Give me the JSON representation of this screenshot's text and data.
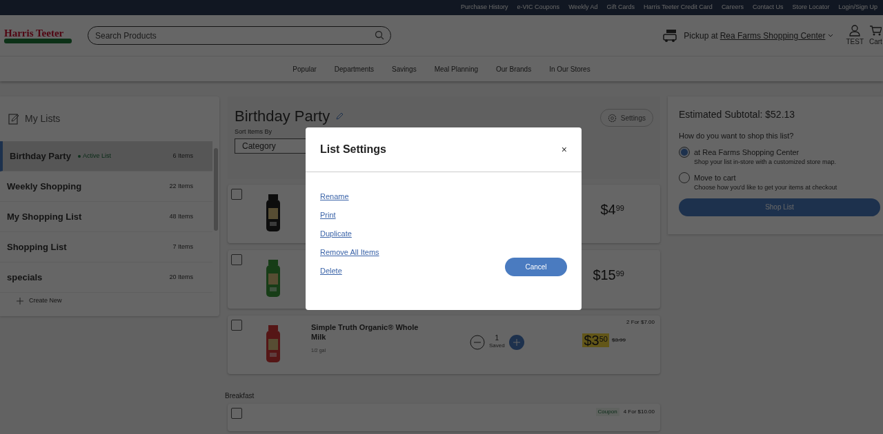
{
  "top_links": [
    "Purchase History",
    "e-VIC Coupons",
    "Weekly Ad",
    "Gift Cards",
    "Harris Teeter Credit Card",
    "Careers",
    "Contact Us",
    "Store Locator",
    "Login/Sign Up"
  ],
  "header": {
    "logo": "Harris Teeter",
    "search_placeholder": "Search Products",
    "pickup_label": "Pickup at",
    "store": "Rea Farms Shopping Center",
    "account": "TEST",
    "cart": "Cart"
  },
  "nav": [
    "Popular",
    "Departments",
    "Savings",
    "Meal Planning",
    "Our Brands",
    "In Our Stores"
  ],
  "sidebar": {
    "title": "My Lists",
    "lists": [
      {
        "name": "Birthday Party",
        "count": "6 Items",
        "selected": true,
        "badge": "Active List"
      },
      {
        "name": "Weekly Shopping",
        "count": "22 Items",
        "selected": false
      },
      {
        "name": "My Shopping List",
        "count": "48 Items",
        "selected": false
      },
      {
        "name": "Shopping List",
        "count": "7 Items",
        "selected": false
      },
      {
        "name": "specials",
        "count": "20 Items",
        "selected": false
      }
    ],
    "create": "Create New"
  },
  "main": {
    "title": "Birthday Party",
    "sort_label": "Sort Items By",
    "sort_value": "Category",
    "settings": "Settings",
    "items": [
      {
        "checked": false,
        "dollars": "$4",
        "cents": "99",
        "sale": false
      },
      {
        "checked": false,
        "dollars": "$15",
        "cents": "99",
        "sale": false
      },
      {
        "checked": false,
        "name": "Simple Truth Organic® Whole Milk",
        "size": "1/2 gal",
        "qty": "1",
        "qty_label": "Saved",
        "dollars": "$3",
        "cents": "50",
        "sale": true,
        "was": "$3.99",
        "deal": "2 For $7.00"
      }
    ],
    "section": "Breakfast",
    "next_item": {
      "checked": false,
      "coupon": "Coupon",
      "deal": "4 For $10.00"
    }
  },
  "summary": {
    "subtotal": "Estimated Subtotal: $52.13",
    "question": "How do you want to shop this list?",
    "options": [
      {
        "label": "at Rea Farms Shopping Center",
        "desc": "Shop your list in-store with a customized store map.",
        "selected": true
      },
      {
        "label": "Move to cart",
        "desc": "Choose how you'd like to get your items at checkout",
        "selected": false
      }
    ],
    "button": "Shop List"
  },
  "modal": {
    "title": "List Settings",
    "close": "×",
    "links": [
      "Rename",
      "Print",
      "Duplicate",
      "Remove All Items",
      "Delete"
    ],
    "cancel": "Cancel"
  }
}
